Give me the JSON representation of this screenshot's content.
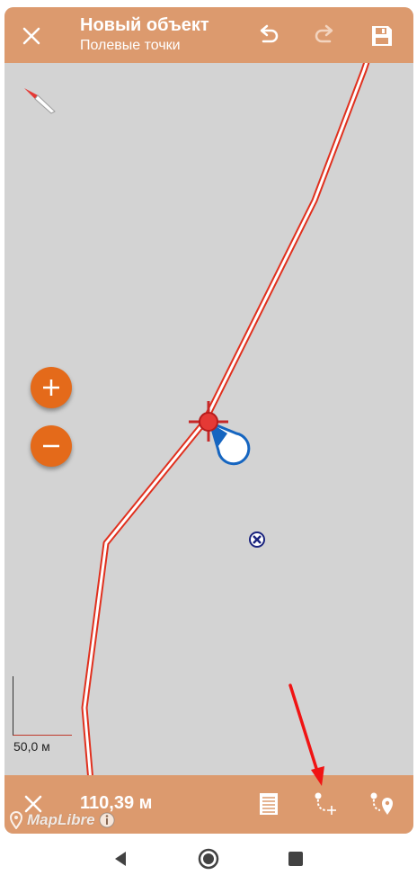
{
  "header": {
    "title": "Новый объект",
    "subtitle": "Полевые точки",
    "icons": {
      "close": "close-icon",
      "undo": "undo-icon",
      "redo": "redo-icon",
      "save": "save-icon"
    }
  },
  "map": {
    "compass_icon": "compass-icon",
    "zoom_in_label": "+",
    "zoom_out_label": "−",
    "scale_label": "50,0 м",
    "attribution": "MapLibre",
    "colors": {
      "background": "#d3d3d3",
      "line": "#e0301e",
      "accent": "#e46a1a",
      "location": "#1565c0"
    }
  },
  "bottom": {
    "distance": "110,39 м",
    "icons": {
      "close": "close-icon",
      "list": "list-icon",
      "add_vertex": "add-vertex-icon",
      "add_point": "add-point-icon"
    }
  },
  "colors": {
    "bar": "#dc9a6e",
    "annotation_arrow": "#f01414"
  }
}
